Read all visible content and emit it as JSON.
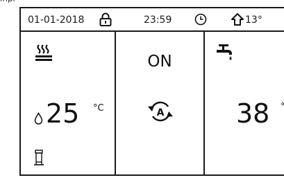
{
  "header_fragment": "lhpr",
  "status_bar": {
    "date": "01-01-2018",
    "time": "23:59",
    "outdoor_temp": "13°",
    "icons": [
      "lock-icon",
      "clock-icon",
      "home-icon"
    ]
  },
  "heating_panel": {
    "icon": "heating-icon",
    "setpoint_icon": "water-drop-icon",
    "temperature": "25",
    "unit": "°C",
    "tank_icon": "tank-heater-icon"
  },
  "mode_panel": {
    "status": "ON",
    "mode_icon": "auto-mode-icon"
  },
  "hot_water_panel": {
    "icon": "tap-icon",
    "temperature": "38",
    "unit": "°"
  }
}
